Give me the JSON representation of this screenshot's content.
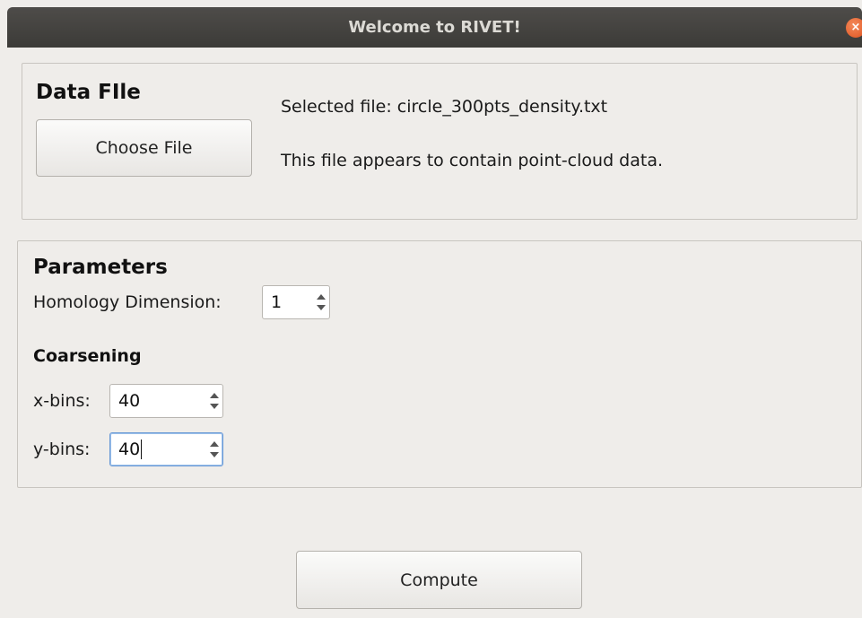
{
  "window": {
    "title": "Welcome to RIVET!",
    "close_glyph": "×"
  },
  "data_file": {
    "heading": "Data FIle",
    "choose_button": "Choose File",
    "selected_file": "Selected file: circle_300pts_density.txt",
    "file_info": "This file appears to contain point-cloud data."
  },
  "parameters": {
    "heading": "Parameters",
    "homology_label": "Homology Dimension:",
    "homology_value": "1",
    "coarsening_heading": "Coarsening",
    "xbins_label": "x-bins:",
    "xbins_value": "40",
    "ybins_label": "y-bins:",
    "ybins_value": "40"
  },
  "actions": {
    "compute_button": "Compute"
  }
}
